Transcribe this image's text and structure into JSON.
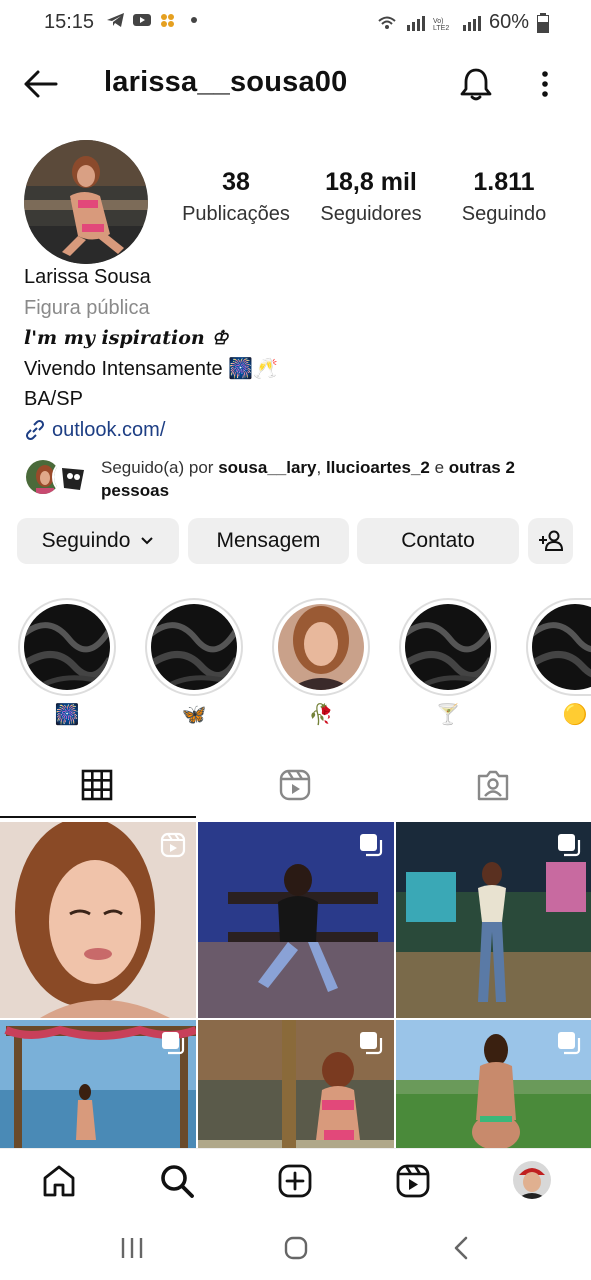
{
  "status_bar": {
    "time": "15:15",
    "battery": "60%",
    "icons": [
      "telegram-icon",
      "youtube-icon",
      "app-icon",
      "dot-icon",
      "wifi-icon",
      "signal-icon",
      "volte-icon",
      "battery-icon"
    ]
  },
  "header": {
    "username": "larissa__sousa00"
  },
  "stats": [
    {
      "value": "38",
      "label": "Publicações"
    },
    {
      "value": "18,8 mil",
      "label": "Seguidores"
    },
    {
      "value": "1.811",
      "label": "Seguindo"
    }
  ],
  "bio": {
    "name": "Larissa Sousa",
    "category": "Figura pública",
    "line1": "l'm my ispiration ♔",
    "line2": "Vivendo Intensamente 🎆🥂",
    "line3": "BA/SP",
    "link": "outlook.com/"
  },
  "followed_by": {
    "prefix": "Seguido(a) por ",
    "user1": "sousa__lary",
    "sep": ", ",
    "user2": "llucioartes_2",
    "and": " e ",
    "others": "outras 2 pessoas"
  },
  "buttons": {
    "following": "Seguindo",
    "message": "Mensagem",
    "contact": "Contato"
  },
  "highlights": [
    {
      "emoji": "🎆"
    },
    {
      "emoji": "🦋"
    },
    {
      "emoji": "🥀"
    },
    {
      "emoji": "🍸"
    },
    {
      "emoji": "🟡"
    }
  ],
  "colors": {
    "link": "#1d3e84",
    "button_bg": "#efefef",
    "muted": "#8a8a8a"
  }
}
